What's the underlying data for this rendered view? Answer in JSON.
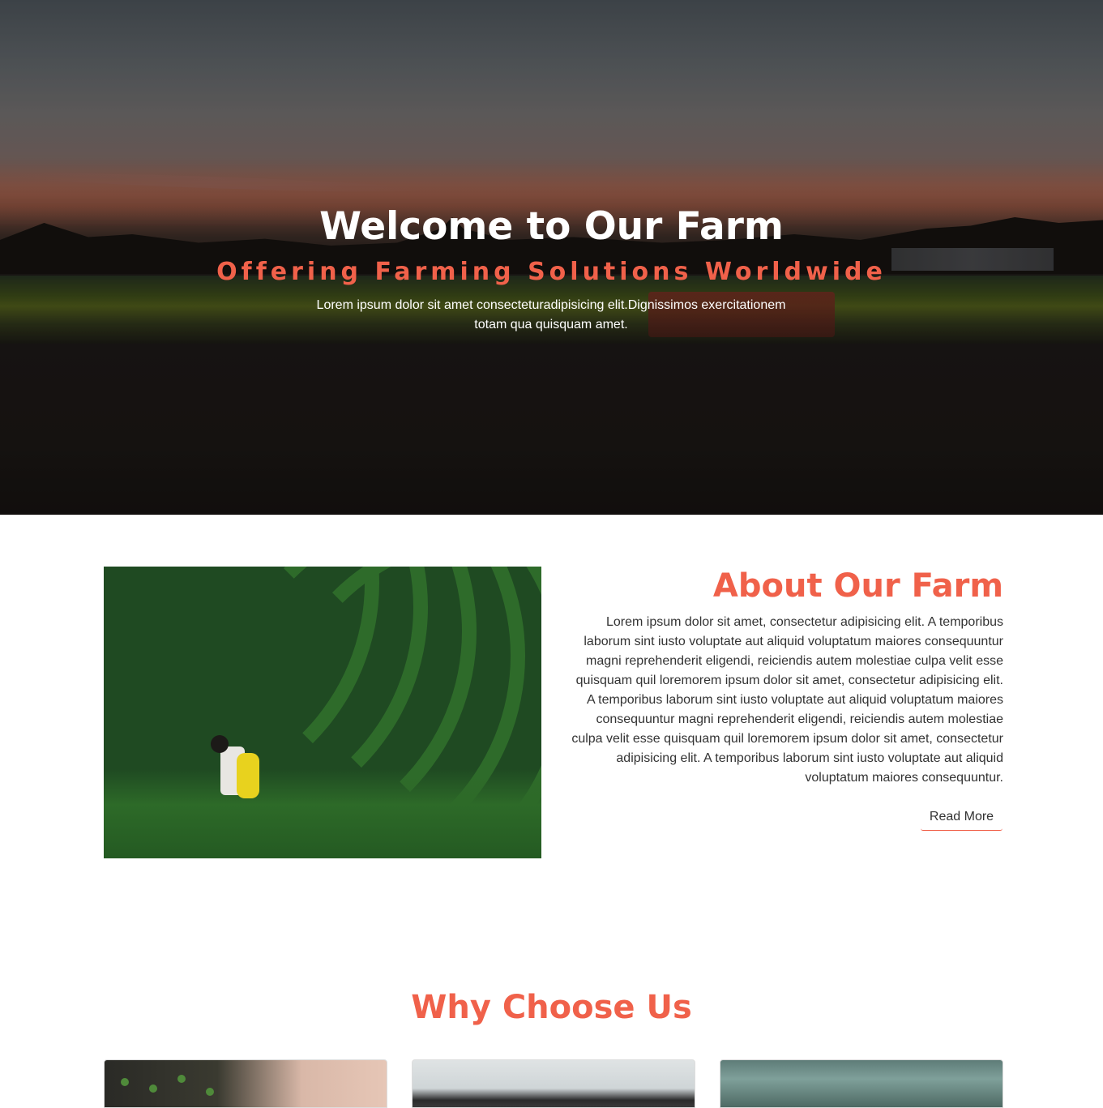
{
  "hero": {
    "title": "Welcome to Our Farm",
    "subtitle": "Offering Farming Solutions Worldwide",
    "text": "Lorem ipsum dolor sit amet consecteturadipisicing elit.Dignissimos exercitationem totam qua quisquam amet."
  },
  "about": {
    "title": "About Our Farm",
    "text": "Lorem ipsum dolor sit amet, consectetur adipisicing elit. A temporibus laborum sint iusto voluptate aut aliquid voluptatum maiores consequuntur magni reprehenderit eligendi, reiciendis autem molestiae culpa velit esse quisquam quil loremorem ipsum dolor sit amet, consectetur adipisicing elit. A temporibus laborum sint iusto voluptate aut aliquid voluptatum maiores consequuntur magni reprehenderit eligendi, reiciendis autem molestiae culpa velit esse quisquam quil loremorem ipsum dolor sit amet, consectetur adipisicing elit. A temporibus laborum sint iusto voluptate aut aliquid voluptatum maiores consequuntur.",
    "read_more_label": "Read More"
  },
  "why": {
    "title": "Why Choose Us"
  },
  "colors": {
    "accent": "#f0614a",
    "text": "#333333",
    "background": "#ffffff"
  }
}
